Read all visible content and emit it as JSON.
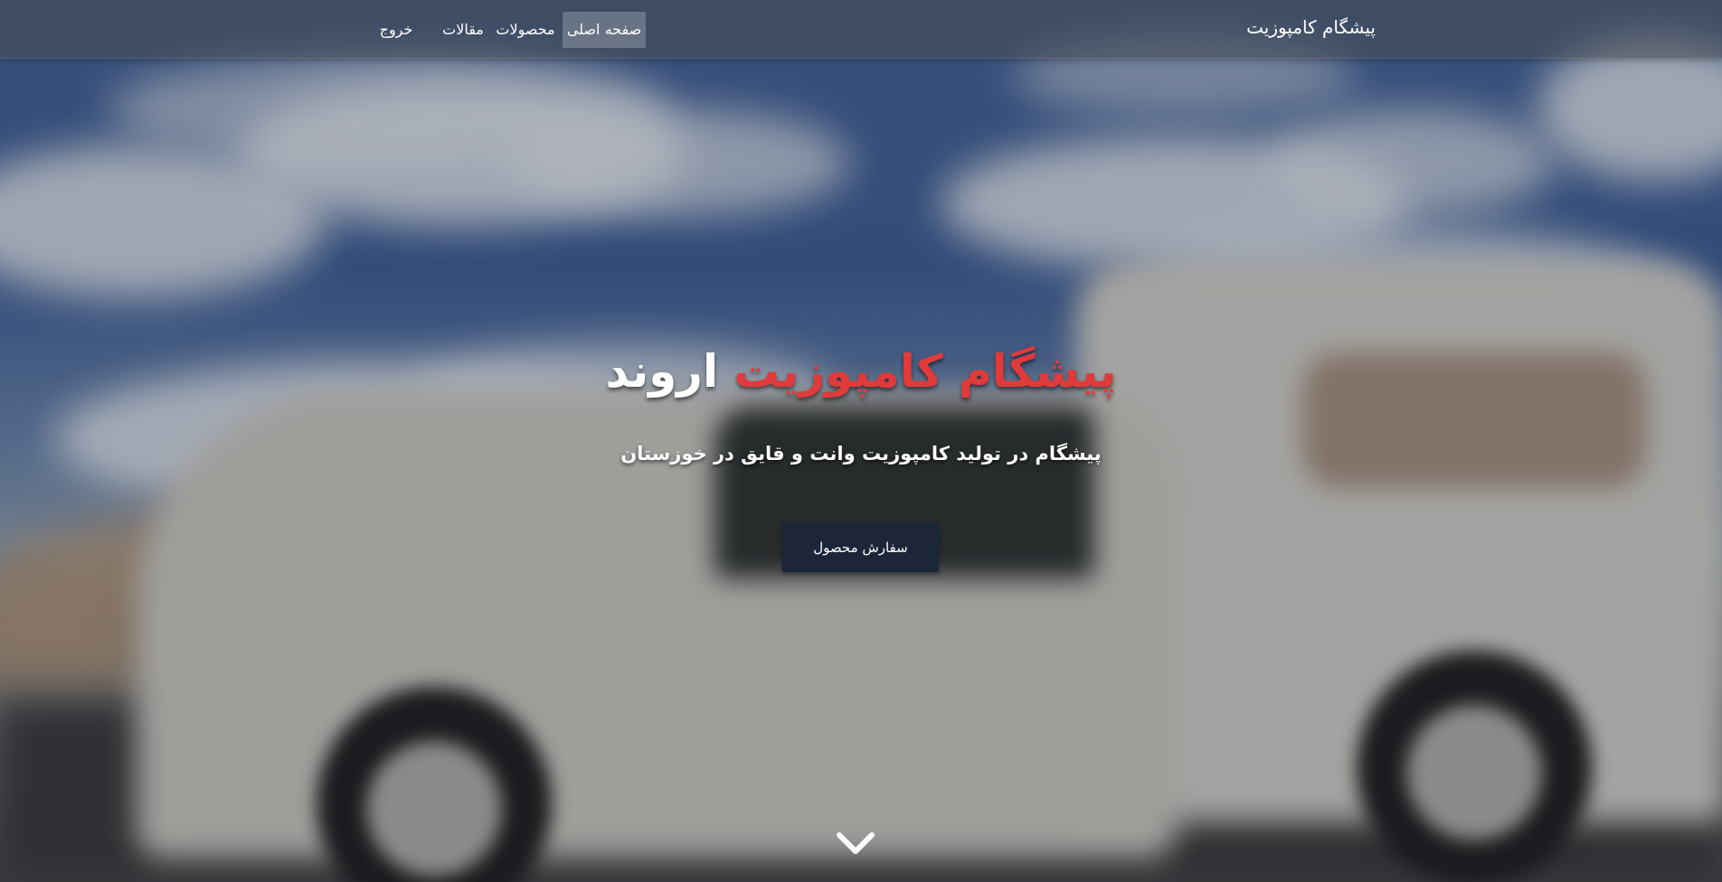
{
  "navbar": {
    "brand": "پیشگام کامپوزیت",
    "items": [
      {
        "label": "صفحه اصلی",
        "active": true
      },
      {
        "label": "محصولات",
        "active": false
      },
      {
        "label": "مقالات",
        "active": false
      },
      {
        "label": "خروج",
        "active": false
      }
    ]
  },
  "hero": {
    "title_accent": "پیشگام کامپوزیت",
    "title_rest": "اروند",
    "subtitle": "پیشگام در تولید کامپوزیت وانت و قایق در خوزستان",
    "order_button": "سفارش محصول",
    "scroll_icon": "chevron-down-icon"
  },
  "colors": {
    "accent_red": "#e03a3a",
    "button_bg": "#1d2639",
    "navbar_bg": "rgba(70, 74, 82, .55)"
  }
}
